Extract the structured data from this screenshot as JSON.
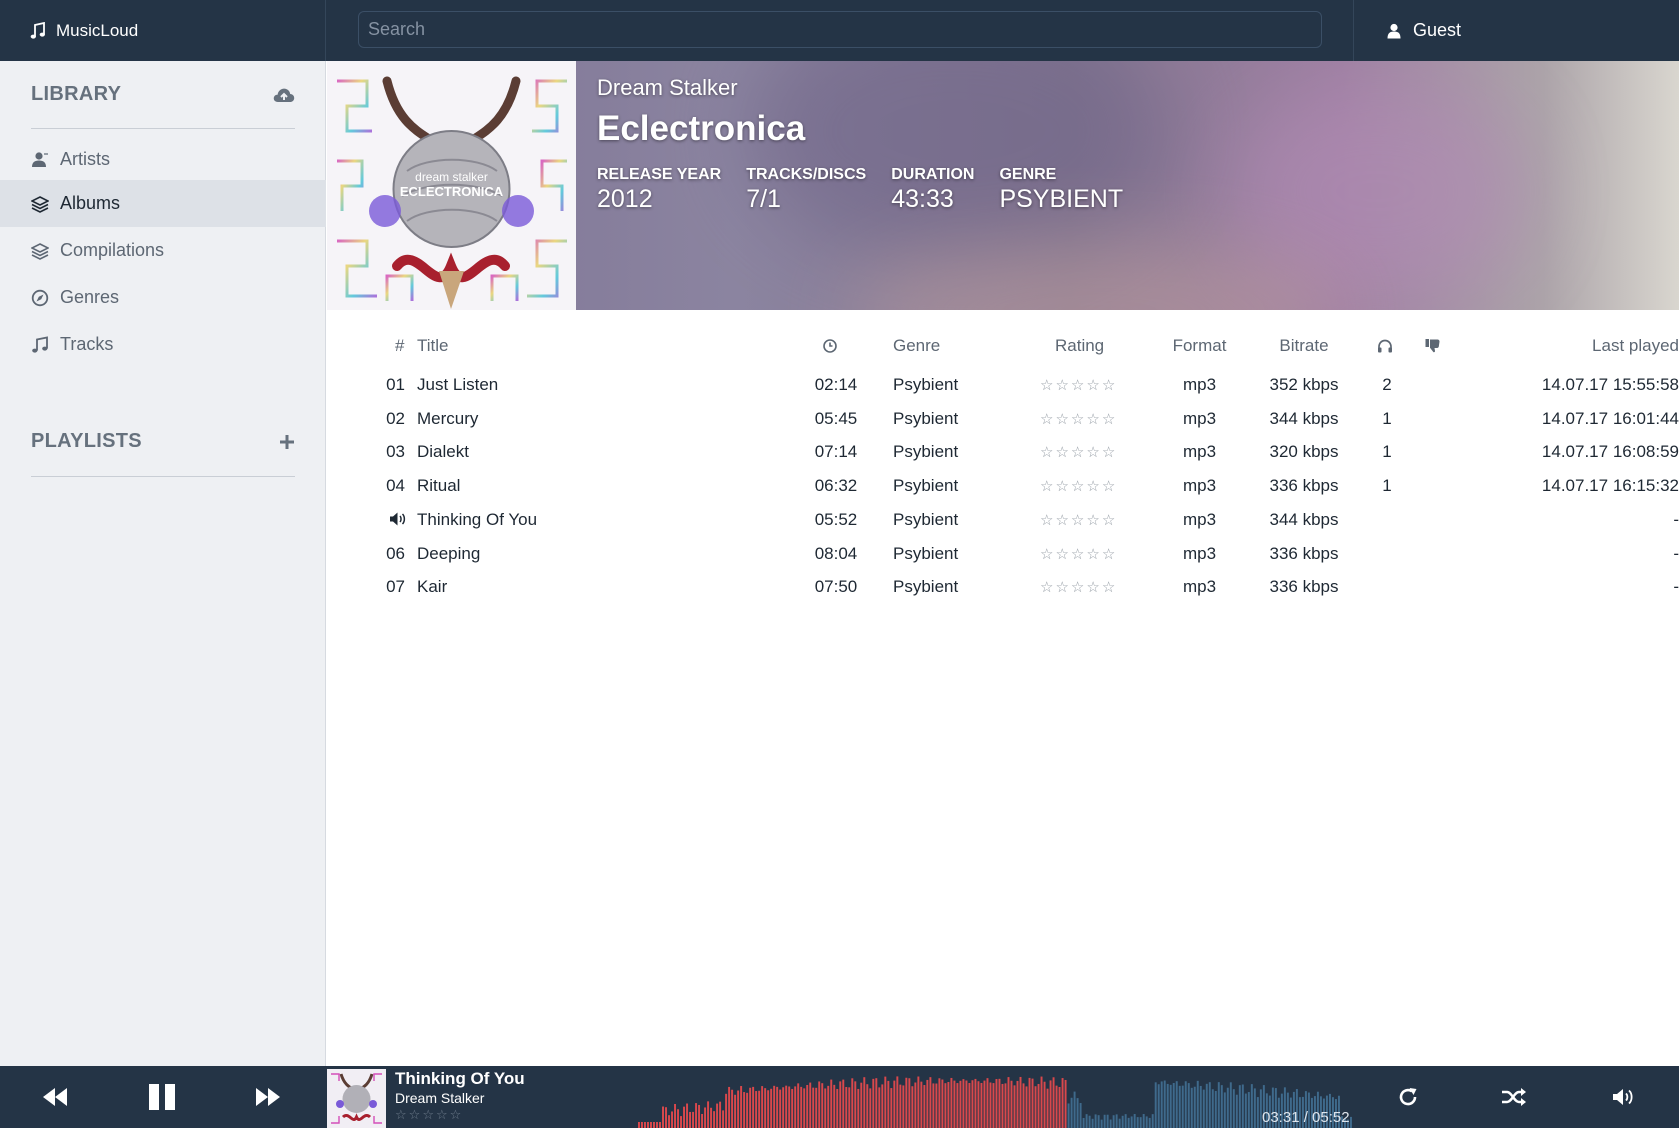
{
  "app": {
    "name": "MusicLoud"
  },
  "search": {
    "placeholder": "Search"
  },
  "user": {
    "name": "Guest"
  },
  "sidebar": {
    "library_title": "LIBRARY",
    "items": [
      {
        "label": "Artists",
        "icon": "user-icon"
      },
      {
        "label": "Albums",
        "icon": "layers-icon"
      },
      {
        "label": "Compilations",
        "icon": "layers-icon"
      },
      {
        "label": "Genres",
        "icon": "compass-icon"
      },
      {
        "label": "Tracks",
        "icon": "music-note-icon"
      }
    ],
    "active": "Albums",
    "playlists_title": "PLAYLISTS"
  },
  "album": {
    "artist": "Dream Stalker",
    "title": "Eclectronica",
    "cover_text_top": "dream stalker",
    "cover_text_bottom": "ECLECTRONICA",
    "stats": [
      {
        "label": "RELEASE YEAR",
        "value": "2012"
      },
      {
        "label": "TRACKS/DISCS",
        "value": "7/1"
      },
      {
        "label": "DURATION",
        "value": "43:33"
      },
      {
        "label": "GENRE",
        "value": "PSYBIENT"
      }
    ]
  },
  "table": {
    "headers": {
      "num": "#",
      "title": "Title",
      "genre": "Genre",
      "rating": "Rating",
      "format": "Format",
      "bitrate": "Bitrate",
      "last_played": "Last played"
    },
    "rows": [
      {
        "num": "01",
        "title": "Just Listen",
        "duration": "02:14",
        "genre": "Psybient",
        "rating": 0,
        "format": "mp3",
        "bitrate": "352 kbps",
        "plays": "2",
        "last_played": "14.07.17 15:55:58"
      },
      {
        "num": "02",
        "title": "Mercury",
        "duration": "05:45",
        "genre": "Psybient",
        "rating": 0,
        "format": "mp3",
        "bitrate": "344 kbps",
        "plays": "1",
        "last_played": "14.07.17 16:01:44"
      },
      {
        "num": "03",
        "title": "Dialekt",
        "duration": "07:14",
        "genre": "Psybient",
        "rating": 0,
        "format": "mp3",
        "bitrate": "320 kbps",
        "plays": "1",
        "last_played": "14.07.17 16:08:59"
      },
      {
        "num": "04",
        "title": "Ritual",
        "duration": "06:32",
        "genre": "Psybient",
        "rating": 0,
        "format": "mp3",
        "bitrate": "336 kbps",
        "plays": "1",
        "last_played": "14.07.17 16:15:32"
      },
      {
        "num": "",
        "playing": true,
        "title": "Thinking Of You",
        "duration": "05:52",
        "genre": "Psybient",
        "rating": 0,
        "format": "mp3",
        "bitrate": "344 kbps",
        "plays": "",
        "last_played": "-"
      },
      {
        "num": "06",
        "title": "Deeping",
        "duration": "08:04",
        "genre": "Psybient",
        "rating": 0,
        "format": "mp3",
        "bitrate": "336 kbps",
        "plays": "",
        "last_played": "-"
      },
      {
        "num": "07",
        "title": "Kair",
        "duration": "07:50",
        "genre": "Psybient",
        "rating": 0,
        "format": "mp3",
        "bitrate": "336 kbps",
        "plays": "",
        "last_played": "-"
      }
    ]
  },
  "player": {
    "title": "Thinking Of You",
    "artist": "Dream Stalker",
    "rating": 0,
    "time": "03:31 / 05:52",
    "progress": 0.5997,
    "colors": {
      "played": "#d9484c",
      "unplayed": "#3f6a8c",
      "bg": "#243446"
    }
  }
}
